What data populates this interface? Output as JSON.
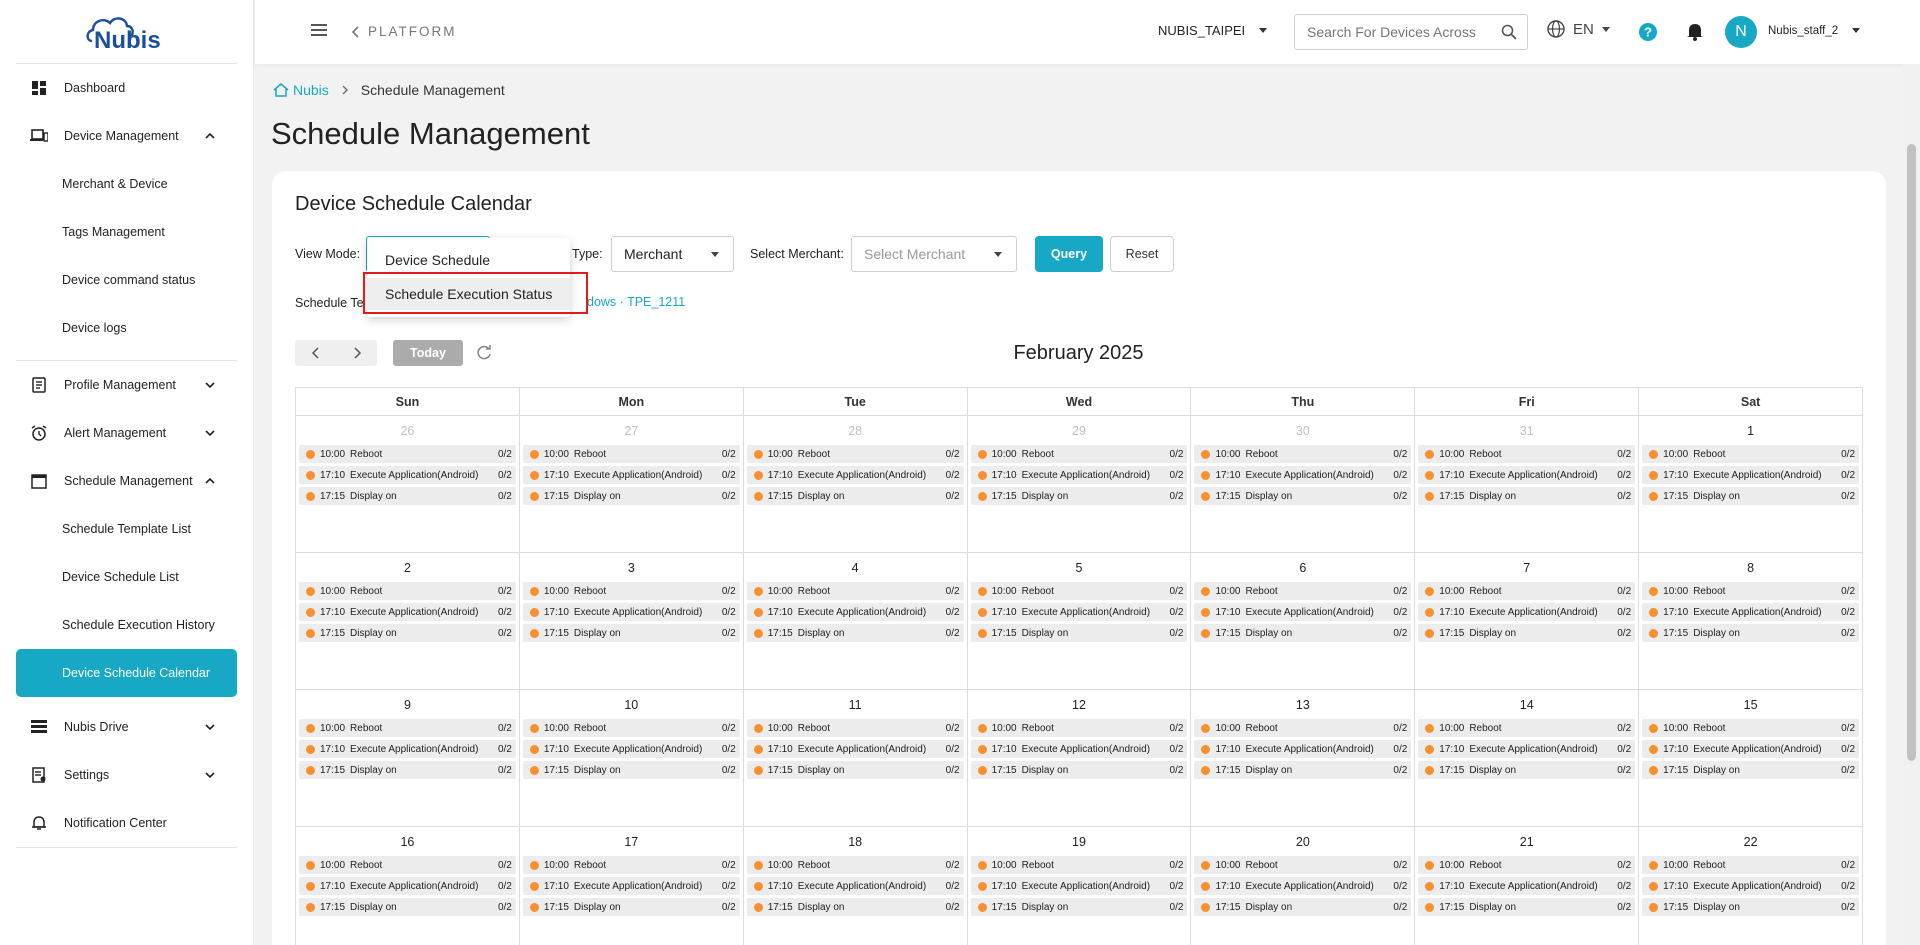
{
  "brand": {
    "logo_text": "Nubis"
  },
  "sidebar": {
    "items": [
      {
        "label": "Dashboard"
      },
      {
        "label": "Device Management",
        "children": [
          "Merchant & Device",
          "Tags Management",
          "Device command status",
          "Device logs"
        ]
      },
      {
        "label": "Profile Management"
      },
      {
        "label": "Alert Management"
      },
      {
        "label": "Schedule Management",
        "children": [
          "Schedule Template List",
          "Device Schedule List",
          "Schedule Execution History",
          "Device Schedule Calendar"
        ]
      },
      {
        "label": "Nubis Drive"
      },
      {
        "label": "Settings"
      },
      {
        "label": "Notification Center"
      }
    ],
    "active": "Device Schedule Calendar"
  },
  "topbar": {
    "platform": "PLATFORM",
    "org": "NUBIS_TAIPEI",
    "search_placeholder": "Search For Devices Across",
    "lang": "EN",
    "avatar_letter": "N",
    "username": "Nubis_staff_2"
  },
  "breadcrumb": {
    "home": "Nubis",
    "current": "Schedule Management"
  },
  "page_title": "Schedule Management",
  "card": {
    "title": "Device Schedule Calendar",
    "view_mode_label": "View Mode:",
    "type_label": "Type:",
    "type_value": "Merchant",
    "merchant_label": "Select Merchant:",
    "merchant_placeholder": "Select Merchant",
    "query": "Query",
    "reset": "Reset",
    "templates_label": "Schedule Te",
    "templates_value": "dows · TPE_1211",
    "today": "Today",
    "month": "February 2025"
  },
  "dropdown": {
    "options": [
      "Device Schedule",
      "Schedule Execution Status"
    ],
    "highlighted": "Schedule Execution Status"
  },
  "calendar": {
    "weekdays": [
      "Sun",
      "Mon",
      "Tue",
      "Wed",
      "Thu",
      "Fri",
      "Sat"
    ],
    "weeks": [
      [
        {
          "d": "26",
          "o": true
        },
        {
          "d": "27",
          "o": true
        },
        {
          "d": "28",
          "o": true
        },
        {
          "d": "29",
          "o": true
        },
        {
          "d": "30",
          "o": true
        },
        {
          "d": "31",
          "o": true
        },
        {
          "d": "1",
          "o": false
        }
      ],
      [
        {
          "d": "2",
          "o": false
        },
        {
          "d": "3",
          "o": false
        },
        {
          "d": "4",
          "o": false
        },
        {
          "d": "5",
          "o": false
        },
        {
          "d": "6",
          "o": false
        },
        {
          "d": "7",
          "o": false
        },
        {
          "d": "8",
          "o": false
        }
      ],
      [
        {
          "d": "9",
          "o": false
        },
        {
          "d": "10",
          "o": false
        },
        {
          "d": "11",
          "o": false
        },
        {
          "d": "12",
          "o": false
        },
        {
          "d": "13",
          "o": false
        },
        {
          "d": "14",
          "o": false
        },
        {
          "d": "15",
          "o": false
        }
      ],
      [
        {
          "d": "16",
          "o": false
        },
        {
          "d": "17",
          "o": false
        },
        {
          "d": "18",
          "o": false
        },
        {
          "d": "19",
          "o": false
        },
        {
          "d": "20",
          "o": false
        },
        {
          "d": "21",
          "o": false
        },
        {
          "d": "22",
          "o": false
        }
      ]
    ],
    "events": [
      {
        "time": "10:00",
        "title": "Reboot",
        "count": "0/2"
      },
      {
        "time": "17:10",
        "title": "Execute Application(Android)",
        "count": "0/2"
      },
      {
        "time": "17:15",
        "title": "Display on",
        "count": "0/2"
      }
    ],
    "event_color": "#f6912e"
  },
  "colors": {
    "accent": "#17a8c5",
    "highlight_border": "#e01b1b"
  }
}
